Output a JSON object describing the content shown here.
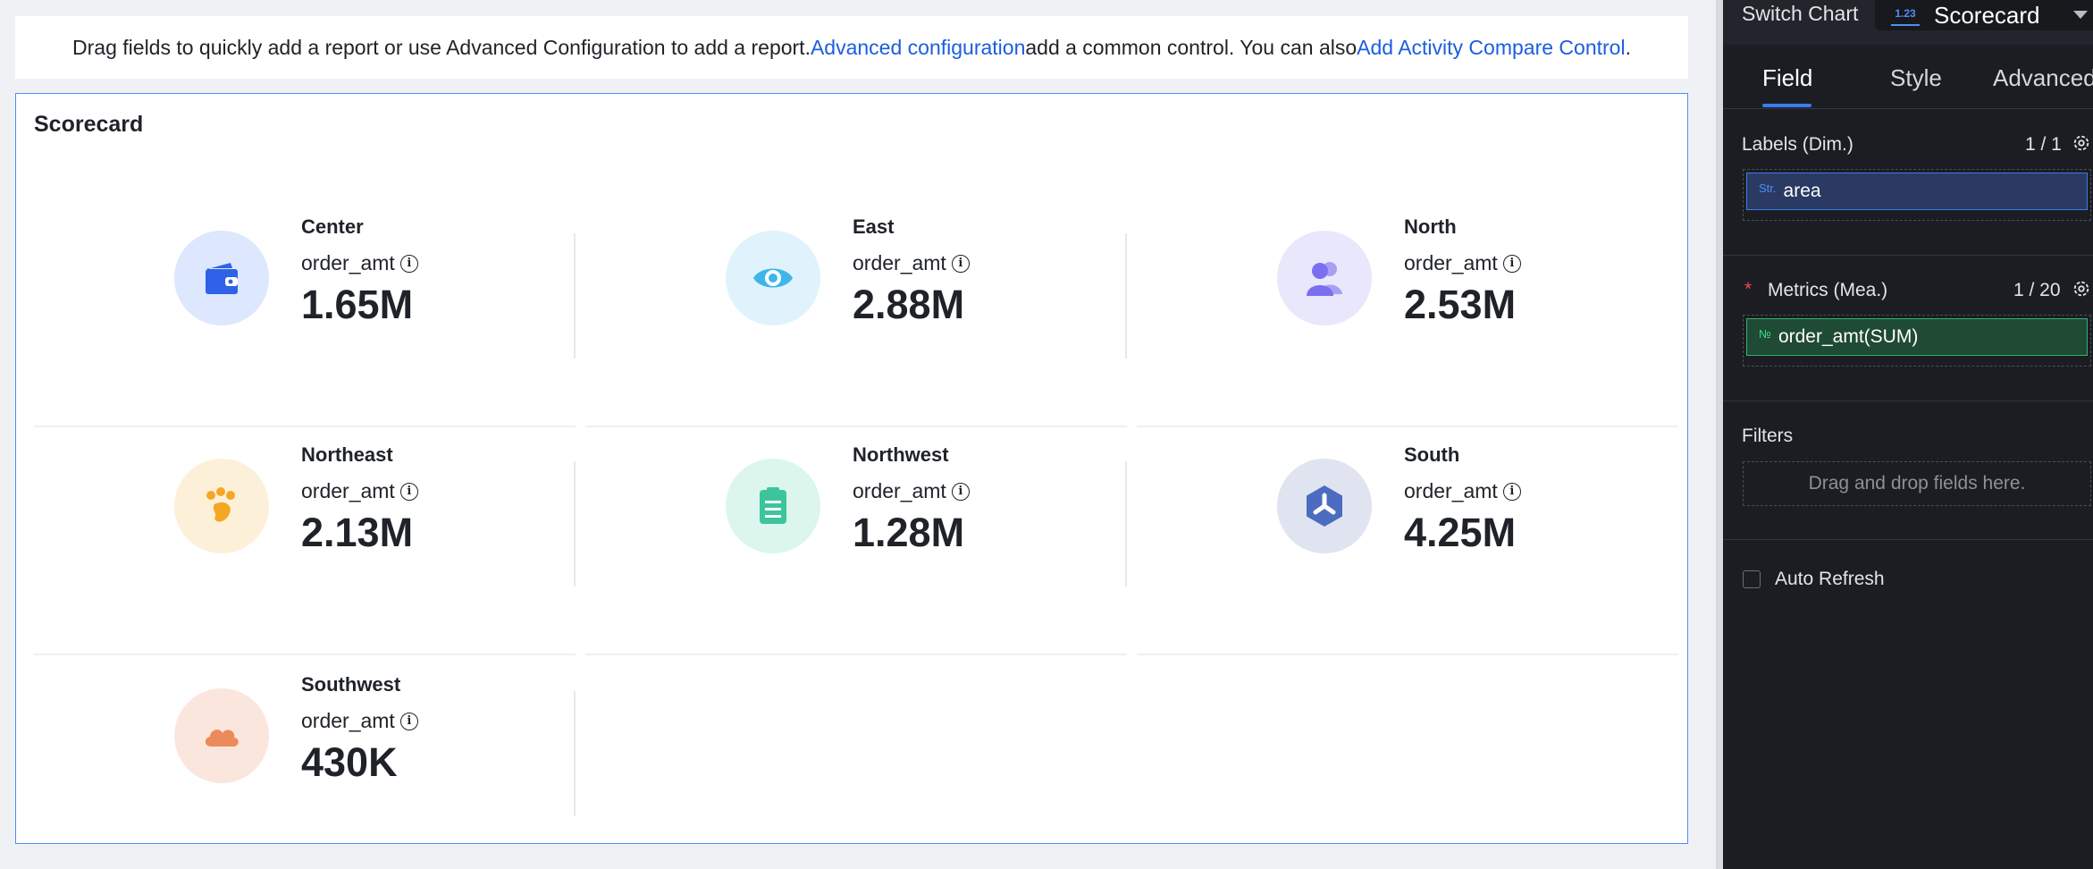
{
  "banner": {
    "text1": "Drag fields to quickly add a report or use Advanced Configuration to add a report.",
    "link1": "Advanced configuration",
    "text2": "add a common control. You can also",
    "link2": "Add Activity Compare Control",
    "text3": "."
  },
  "card": {
    "title": "Scorecard",
    "tiles": [
      {
        "name": "Center",
        "metric": "order_amt",
        "value": "1.65M",
        "icon": "wallet-icon",
        "icon_bg": "#dde7fd",
        "icon_color": "#2f62e8"
      },
      {
        "name": "East",
        "metric": "order_amt",
        "value": "2.88M",
        "icon": "eye-icon",
        "icon_bg": "#e0f3fd",
        "icon_color": "#3fb6ea"
      },
      {
        "name": "North",
        "metric": "order_amt",
        "value": "2.53M",
        "icon": "users-icon",
        "icon_bg": "#e9e7fb",
        "icon_color": "#7b6ff0"
      },
      {
        "name": "Northeast",
        "metric": "order_amt",
        "value": "2.13M",
        "icon": "footprint-icon",
        "icon_bg": "#fdf0d8",
        "icon_color": "#f5a623"
      },
      {
        "name": "Northwest",
        "metric": "order_amt",
        "value": "1.28M",
        "icon": "clipboard-icon",
        "icon_bg": "#dcf6ee",
        "icon_color": "#3cc59b"
      },
      {
        "name": "South",
        "metric": "order_amt",
        "value": "4.25M",
        "icon": "hexagon-icon",
        "icon_bg": "#e0e4f0",
        "icon_color": "#4b6cc0"
      },
      {
        "name": "Southwest",
        "metric": "order_amt",
        "value": "430K",
        "icon": "cloud-icon",
        "icon_bg": "#fbe6de",
        "icon_color": "#eb8b5c"
      }
    ]
  },
  "panel": {
    "switch_label": "Switch Chart",
    "chart_icon_text": "1.23",
    "chart_name": "Scorecard",
    "tabs": [
      "Field",
      "Style",
      "Advanced"
    ],
    "active_tab": "Field",
    "labels": {
      "title": "Labels (Dim.)",
      "count": "1 / 1",
      "field_type": "Str.",
      "field_name": "area"
    },
    "metrics": {
      "required_mark": "*",
      "title": "Metrics (Mea.)",
      "count": "1 / 20",
      "field_type": "№",
      "field_name": "order_amt(SUM)"
    },
    "filters": {
      "title": "Filters",
      "placeholder": "Drag and drop fields here."
    },
    "auto_refresh": {
      "label": "Auto Refresh",
      "checked": false
    }
  }
}
